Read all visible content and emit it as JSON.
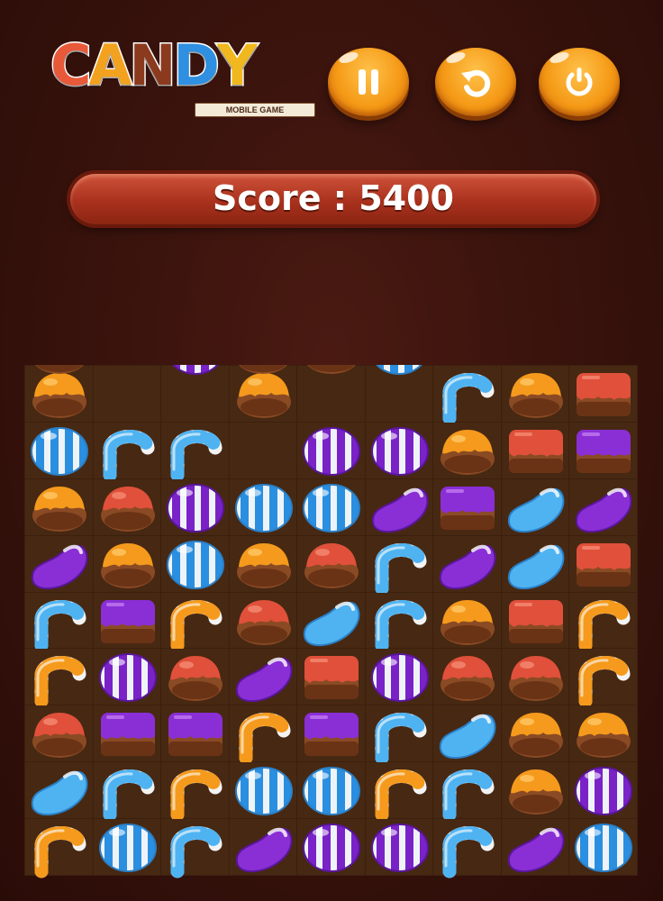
{
  "game": {
    "logo": {
      "letters": [
        "C",
        "A",
        "N",
        "D",
        "Y"
      ],
      "letter_colors": [
        "#e8593a",
        "#f3a21f",
        "#8b3a1e",
        "#2f8fe0",
        "#f0b81e"
      ],
      "subtitle": "MOBILE GAME"
    },
    "buttons": [
      {
        "name": "pause",
        "icon": "pause-icon"
      },
      {
        "name": "restart",
        "icon": "restart-icon"
      },
      {
        "name": "power",
        "icon": "power-icon"
      }
    ],
    "score": {
      "label": "Score",
      "value": "5400",
      "display": "Score : 5400"
    },
    "board": {
      "columns": 9,
      "rows": 9,
      "partial_top_row": [
        "orange-dome",
        "",
        "purple-egg",
        "orange-dome",
        "orange-dome",
        "blue-egg",
        "",
        "",
        ""
      ],
      "grid": [
        [
          "orange-dome",
          "",
          "",
          "orange-dome",
          "",
          "",
          "blue-cane",
          "orange-dome",
          "red-square"
        ],
        [
          "blue-egg",
          "blue-cane",
          "blue-cane",
          "",
          "purple-egg",
          "purple-egg",
          "orange-dome",
          "red-square",
          "purple-square"
        ],
        [
          "orange-dome",
          "red-dome",
          "purple-egg",
          "blue-egg",
          "blue-egg",
          "purple-bean",
          "purple-square",
          "blue-bean",
          "purple-bean"
        ],
        [
          "purple-bean",
          "orange-dome",
          "blue-egg",
          "orange-dome",
          "red-dome",
          "blue-cane",
          "purple-bean",
          "blue-bean",
          "red-square"
        ],
        [
          "blue-cane",
          "purple-square",
          "orange-cane",
          "red-dome",
          "blue-bean",
          "blue-cane",
          "orange-dome",
          "red-square",
          "orange-cane"
        ],
        [
          "orange-cane",
          "purple-egg",
          "red-dome",
          "purple-bean",
          "red-square",
          "purple-egg",
          "red-dome",
          "red-dome",
          "orange-cane"
        ],
        [
          "red-dome",
          "purple-square",
          "purple-square",
          "orange-cane",
          "purple-square",
          "blue-cane",
          "blue-bean",
          "orange-dome",
          "orange-dome"
        ],
        [
          "blue-bean",
          "blue-cane",
          "orange-cane",
          "blue-egg",
          "blue-egg",
          "orange-cane",
          "blue-cane",
          "orange-dome",
          "purple-egg"
        ],
        [
          "orange-cane",
          "blue-egg",
          "blue-cane",
          "purple-bean",
          "purple-egg",
          "purple-egg",
          "blue-cane",
          "purple-bean",
          "blue-egg"
        ]
      ]
    },
    "colors": {
      "background": "#3a130d",
      "board_cell": "#472812",
      "button_orange": "#f59a17",
      "score_bar": "#a9311d",
      "candy_orange": "#f59a1c",
      "candy_red": "#e0503a",
      "candy_blue": "#4fb3f2",
      "candy_purple": "#8a2fd6",
      "chocolate": "#8a4a24"
    }
  }
}
